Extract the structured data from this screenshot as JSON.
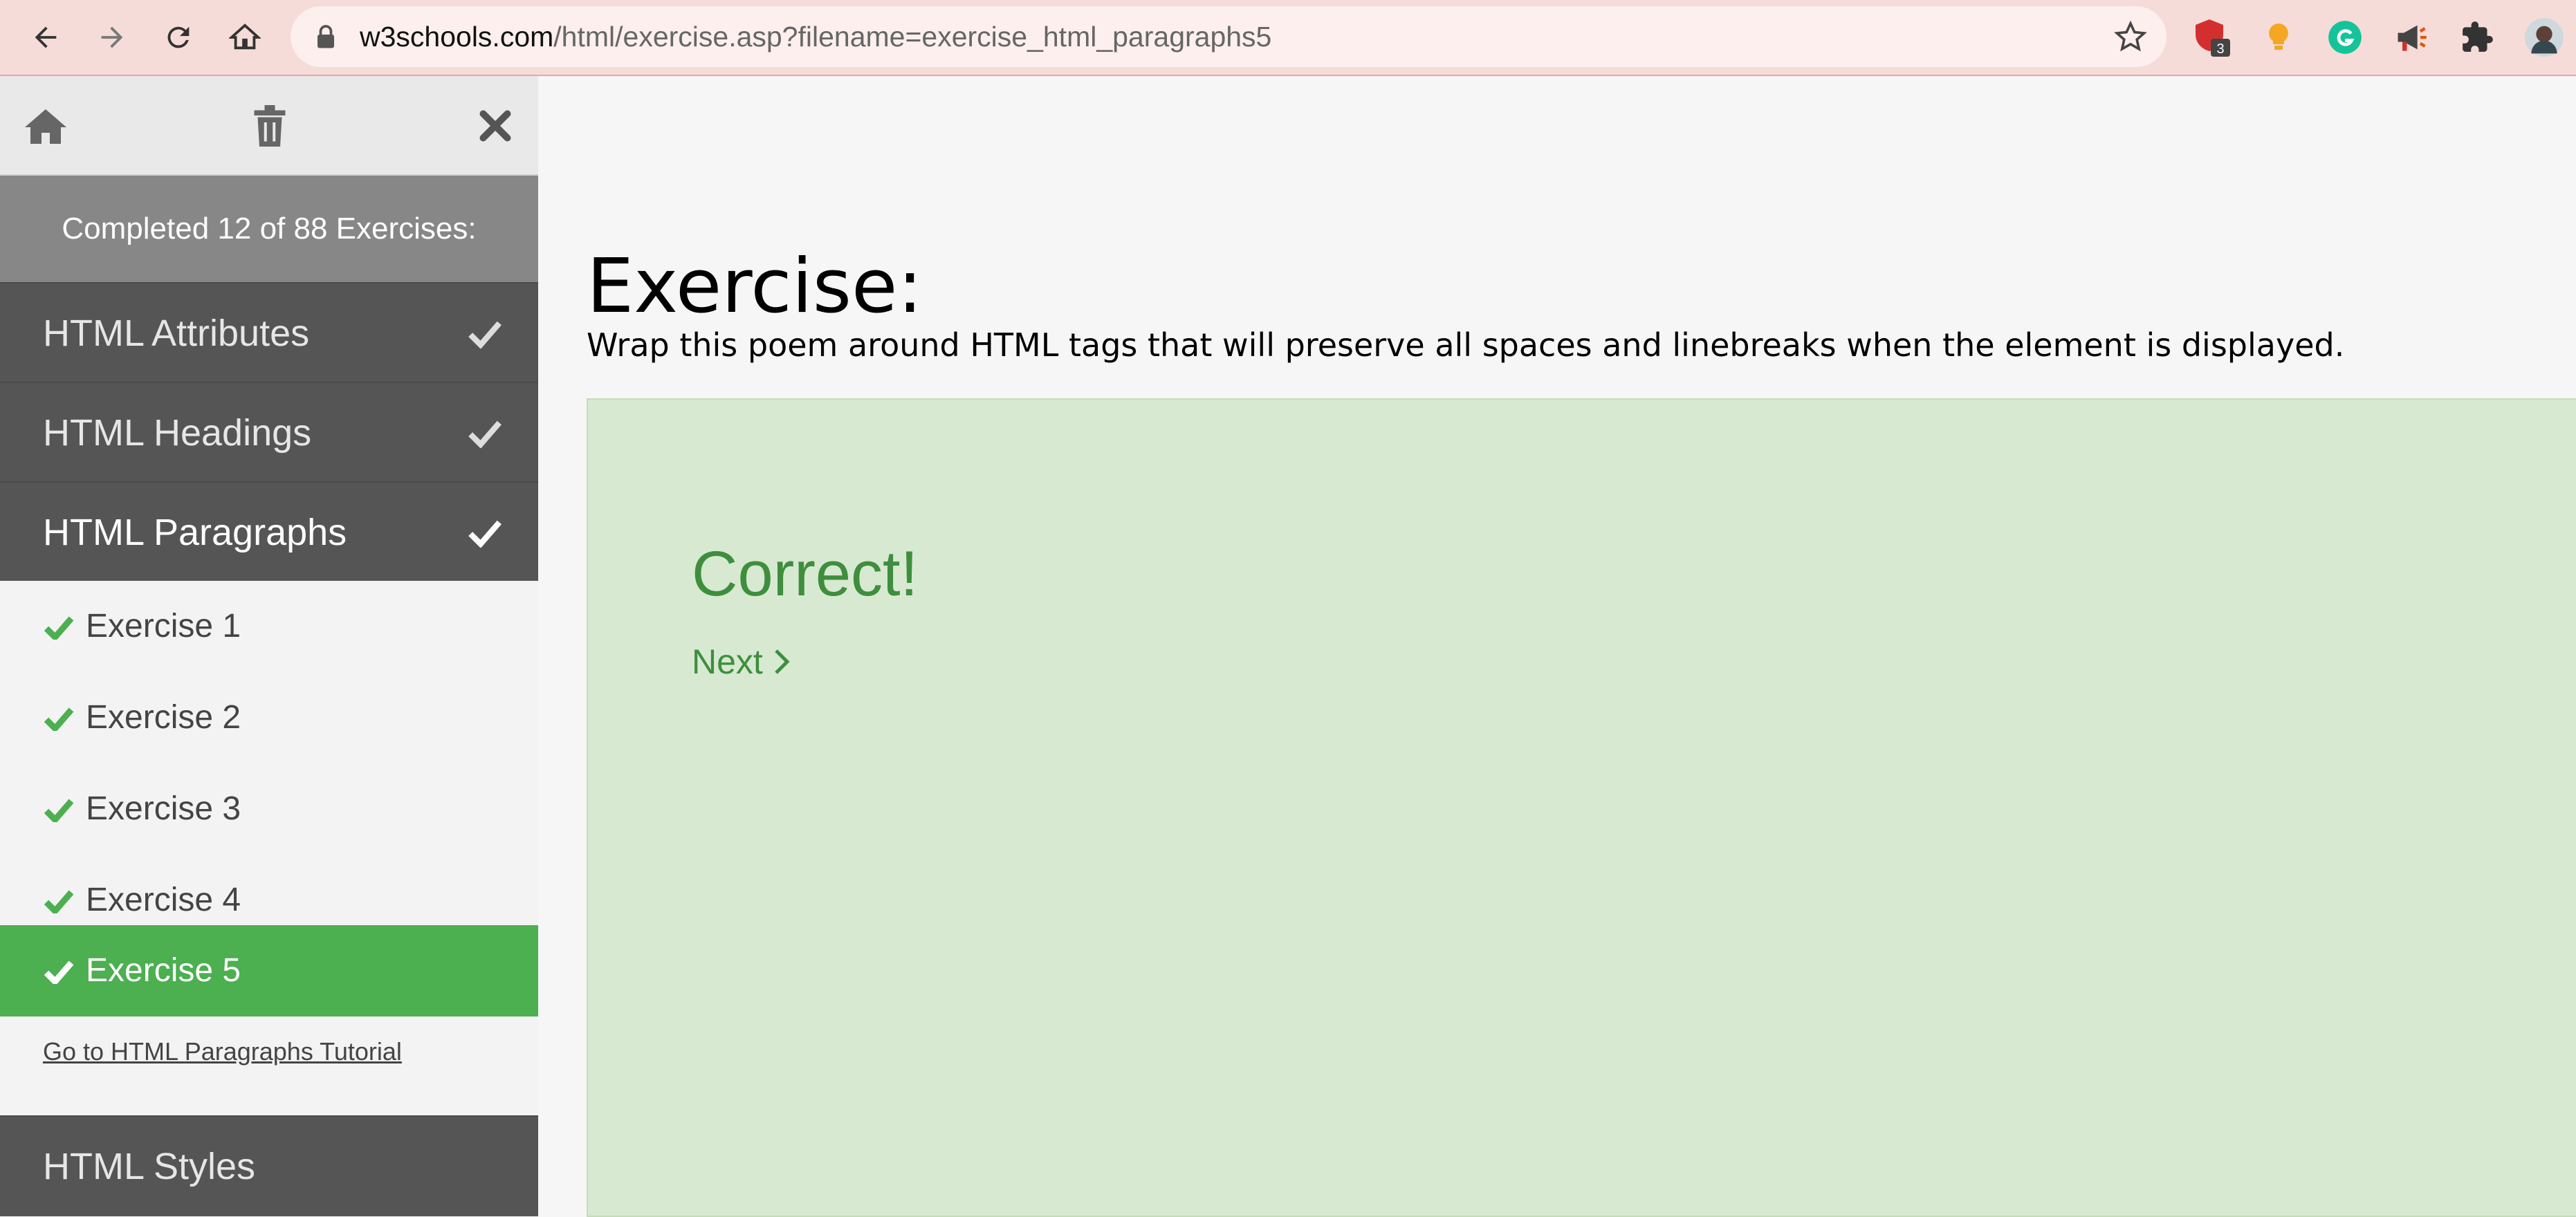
{
  "browser": {
    "url_domain": "w3schools.com",
    "url_path": "/html/exercise.asp?filename=exercise_html_paragraphs5",
    "extension_badge": "3"
  },
  "sidebar": {
    "progress_text": "Completed 12 of 88 Exercises:",
    "categories": [
      {
        "label": "HTML Attributes",
        "completed": true
      },
      {
        "label": "HTML Headings",
        "completed": true
      },
      {
        "label": "HTML Paragraphs",
        "completed": true
      },
      {
        "label": "HTML Styles",
        "completed": false
      }
    ],
    "exercises": [
      {
        "label": "Exercise 1",
        "completed": true
      },
      {
        "label": "Exercise 2",
        "completed": true
      },
      {
        "label": "Exercise 3",
        "completed": true
      },
      {
        "label": "Exercise 4",
        "completed": true
      },
      {
        "label": "Exercise 5",
        "completed": true,
        "active": true
      }
    ],
    "tutorial_link": "Go to HTML Paragraphs Tutorial"
  },
  "main": {
    "title": "Exercise:",
    "instruction": "Wrap this poem around HTML tags that will preserve all spaces and linebreaks when the element is displayed.",
    "result": {
      "status": "Correct!",
      "next_label": "Next"
    }
  },
  "colors": {
    "accent_green": "#4caf50",
    "result_bg": "#d7e9d1",
    "result_text": "#3e8e3e",
    "sidebar_dark": "#555555",
    "browser_bar": "#f6dcd8"
  }
}
